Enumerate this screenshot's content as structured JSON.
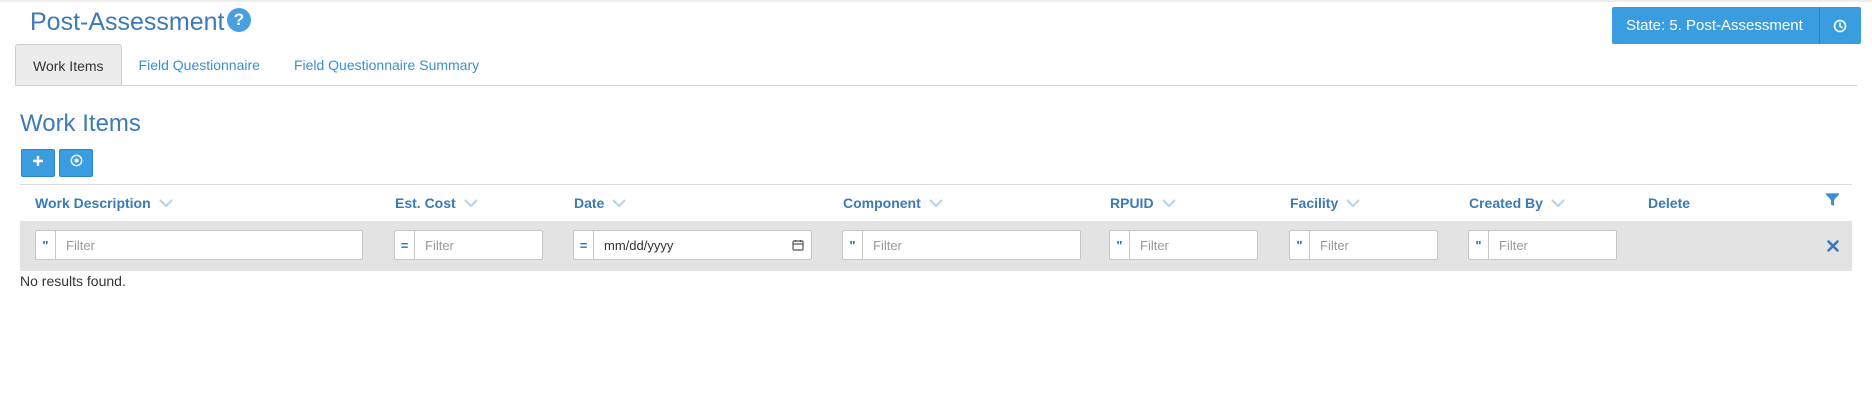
{
  "header": {
    "title": "Post-Assessment",
    "help_icon": "?",
    "state_label": "State: 5. Post-Assessment"
  },
  "tabs": [
    {
      "label": "Work Items",
      "active": true
    },
    {
      "label": "Field Questionnaire",
      "active": false
    },
    {
      "label": "Field Questionnaire Summary",
      "active": false
    }
  ],
  "section": {
    "title": "Work Items",
    "add_icon": "plus-icon",
    "export_icon": "circle-target-icon"
  },
  "grid": {
    "columns": [
      {
        "label": "Work Description"
      },
      {
        "label": "Est. Cost"
      },
      {
        "label": "Date"
      },
      {
        "label": "Component"
      },
      {
        "label": "RPUID"
      },
      {
        "label": "Facility"
      },
      {
        "label": "Created By"
      },
      {
        "label": "Delete"
      }
    ],
    "filters": [
      {
        "op": "\"",
        "placeholder": "Filter"
      },
      {
        "op": "=",
        "placeholder": "Filter"
      },
      {
        "op": "=",
        "placeholder": "mm/dd/yyyy"
      },
      {
        "op": "\"",
        "placeholder": "Filter"
      },
      {
        "op": "\"",
        "placeholder": "Filter"
      },
      {
        "op": "\"",
        "placeholder": "Filter"
      },
      {
        "op": "\"",
        "placeholder": "Filter"
      }
    ],
    "empty_text": "No results found."
  },
  "colors": {
    "accent": "#3a9de0",
    "title": "#3d7ab8",
    "link": "#3a8fd4"
  }
}
